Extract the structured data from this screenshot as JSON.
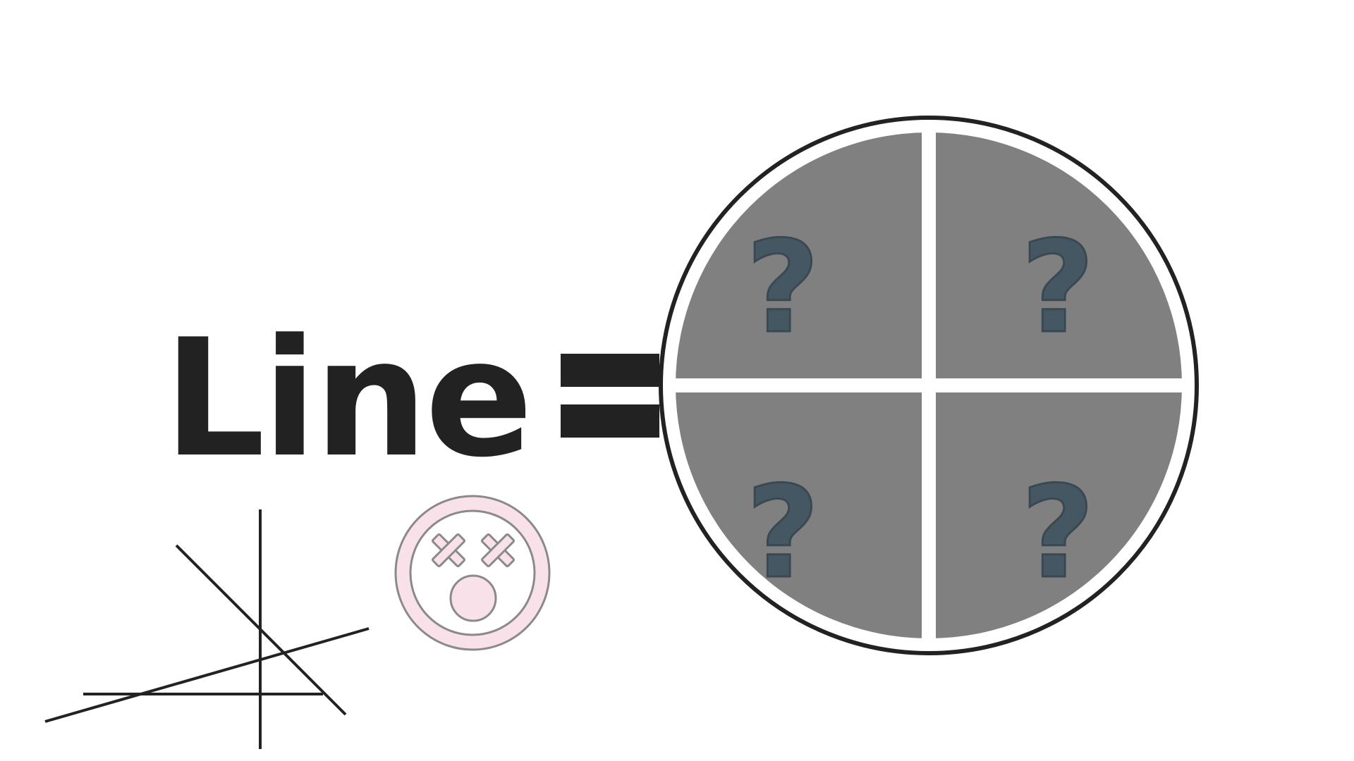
{
  "title": "Line",
  "equals_sign": "=",
  "quadrant_marks": [
    "?",
    "?",
    "?",
    "?"
  ],
  "colors": {
    "ink": "#222222",
    "quadrant_fill": "#808080",
    "question_mark": "#455763",
    "question_outline": "#3a4852",
    "face_fill": "#f9e1e9",
    "face_outline": "#8a8a8a",
    "background": "#ffffff"
  },
  "icons": {
    "crossing_lines": "intersecting-lines-icon",
    "face": "dizzy-face-icon"
  }
}
